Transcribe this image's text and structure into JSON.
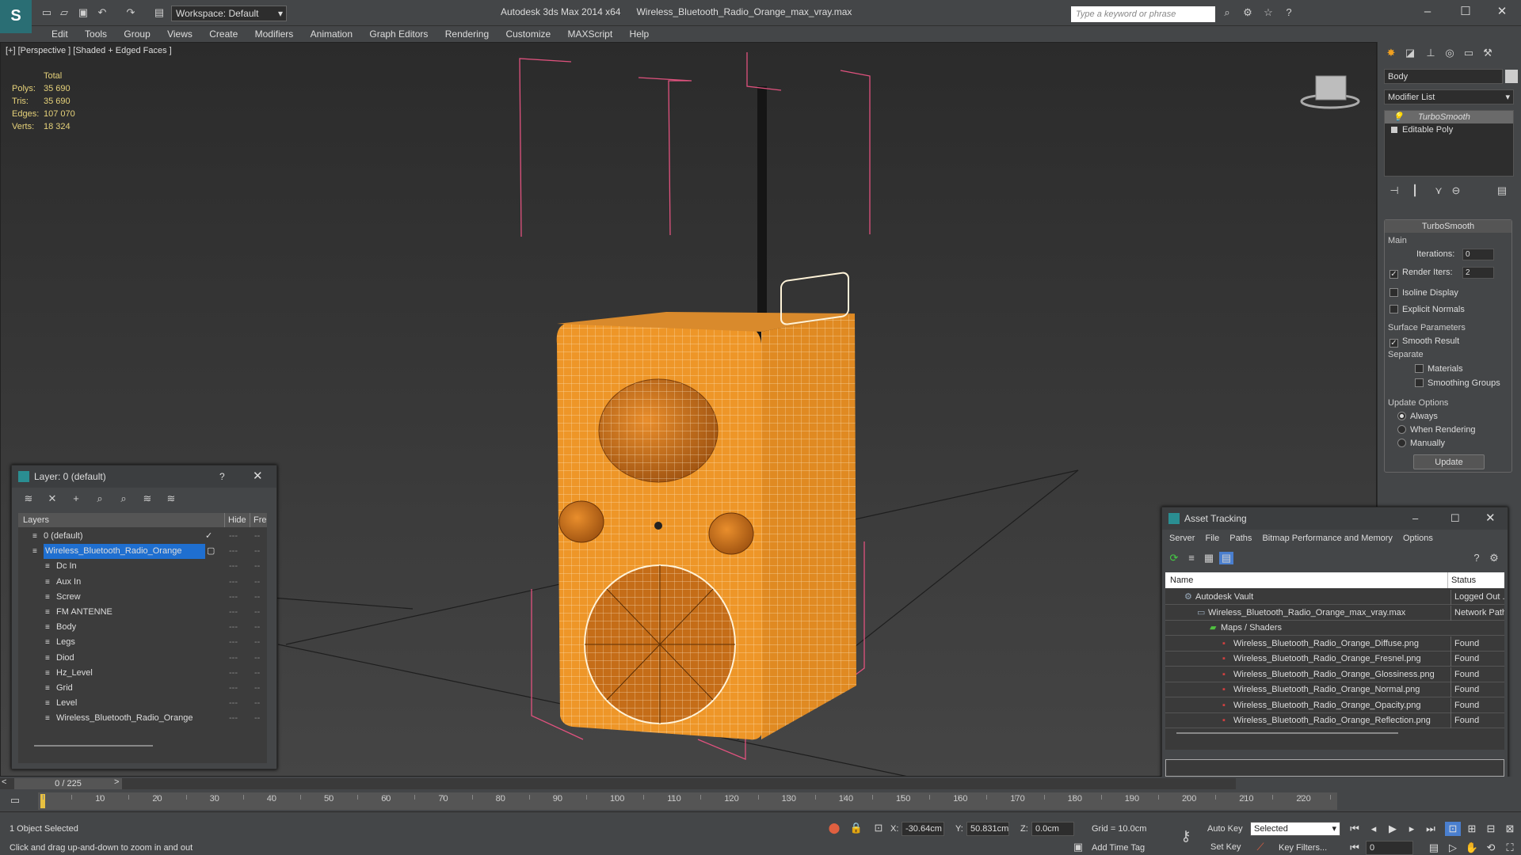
{
  "app": {
    "name": "Autodesk 3ds Max  2014 x64",
    "file": "Wireless_Bluetooth_Radio_Orange_max_vray.max",
    "workspace": "Workspace: Default",
    "search_placeholder": "Type a keyword or phrase"
  },
  "menu": [
    "Edit",
    "Tools",
    "Group",
    "Views",
    "Create",
    "Modifiers",
    "Animation",
    "Graph Editors",
    "Rendering",
    "Customize",
    "MAXScript",
    "Help"
  ],
  "viewport": {
    "label": "[+] [Perspective ] [Shaded + Edged Faces ]",
    "stats": {
      "header": "Total",
      "rows": [
        {
          "k": "Polys:",
          "v": "35 690"
        },
        {
          "k": "Tris:",
          "v": "35 690"
        },
        {
          "k": "Edges:",
          "v": "107 070"
        },
        {
          "k": "Verts:",
          "v": "18 324"
        }
      ]
    }
  },
  "command_panel": {
    "object_name": "Body",
    "modifier_list": "Modifier List",
    "stack": [
      "TurboSmooth",
      "Editable Poly"
    ],
    "rollout": {
      "title": "TurboSmooth",
      "main_label": "Main",
      "iterations_label": "Iterations:",
      "iterations": "0",
      "render_iters_label": "Render Iters:",
      "render_iters": "2",
      "isoline": "Isoline Display",
      "explicit_normals": "Explicit Normals",
      "surface_params": "Surface Parameters",
      "smooth_result": "Smooth Result",
      "separate": "Separate",
      "materials": "Materials",
      "smoothing_groups": "Smoothing Groups",
      "update_options": "Update Options",
      "always": "Always",
      "when_rendering": "When Rendering",
      "manually": "Manually",
      "update": "Update"
    }
  },
  "layer_panel": {
    "title": "Layer: 0 (default)",
    "help": "?",
    "col_layers": "Layers",
    "col_hide": "Hide",
    "col_freeze": "Fre",
    "rows": [
      {
        "name": "0 (default)",
        "indent": 0,
        "selected": false
      },
      {
        "name": "Wireless_Bluetooth_Radio_Orange",
        "indent": 0,
        "selected": true
      },
      {
        "name": "Dc In",
        "indent": 1,
        "selected": false
      },
      {
        "name": "Aux In",
        "indent": 1,
        "selected": false
      },
      {
        "name": "Screw",
        "indent": 1,
        "selected": false
      },
      {
        "name": "FM ANTENNE",
        "indent": 1,
        "selected": false
      },
      {
        "name": "Body",
        "indent": 1,
        "selected": false
      },
      {
        "name": "Legs",
        "indent": 1,
        "selected": false
      },
      {
        "name": "Diod",
        "indent": 1,
        "selected": false
      },
      {
        "name": "Hz_Level",
        "indent": 1,
        "selected": false
      },
      {
        "name": "Grid",
        "indent": 1,
        "selected": false
      },
      {
        "name": "Level",
        "indent": 1,
        "selected": false
      },
      {
        "name": "Wireless_Bluetooth_Radio_Orange",
        "indent": 1,
        "selected": false
      }
    ]
  },
  "asset_tracking": {
    "title": "Asset Tracking",
    "menu": [
      "Server",
      "File",
      "Paths",
      "Bitmap Performance and Memory",
      "Options"
    ],
    "col_name": "Name",
    "col_status": "Status",
    "rows": [
      {
        "name": "Autodesk Vault",
        "status": "Logged Out ...",
        "indent": 1
      },
      {
        "name": "Wireless_Bluetooth_Radio_Orange_max_vray.max",
        "status": "Network Path",
        "indent": 2
      },
      {
        "name": "Maps / Shaders",
        "status": "",
        "indent": 3
      },
      {
        "name": "Wireless_Bluetooth_Radio_Orange_Diffuse.png",
        "status": "Found",
        "indent": 4
      },
      {
        "name": "Wireless_Bluetooth_Radio_Orange_Fresnel.png",
        "status": "Found",
        "indent": 4
      },
      {
        "name": "Wireless_Bluetooth_Radio_Orange_Glossiness.png",
        "status": "Found",
        "indent": 4
      },
      {
        "name": "Wireless_Bluetooth_Radio_Orange_Normal.png",
        "status": "Found",
        "indent": 4
      },
      {
        "name": "Wireless_Bluetooth_Radio_Orange_Opacity.png",
        "status": "Found",
        "indent": 4
      },
      {
        "name": "Wireless_Bluetooth_Radio_Orange_Reflection.png",
        "status": "Found",
        "indent": 4
      }
    ]
  },
  "timeline": {
    "frame": "0 / 225",
    "ticks": [
      "10",
      "20",
      "30",
      "40",
      "50",
      "60",
      "70",
      "80",
      "90",
      "100",
      "110",
      "120",
      "130",
      "140",
      "150",
      "160",
      "170",
      "180",
      "190",
      "200",
      "210",
      "220"
    ]
  },
  "status": {
    "selected": "1 Object Selected",
    "hint": "Click and drag up-and-down to zoom in and out",
    "x_label": "X:",
    "x": "-30.64cm",
    "y_label": "Y:",
    "y": "50.831cm",
    "z_label": "Z:",
    "z": "0.0cm",
    "grid": "Grid = 10.0cm",
    "add_time_tag": "Add Time Tag",
    "auto_key": "Auto Key",
    "set_key": "Set Key",
    "selected_dropdown": "Selected",
    "key_filters": "Key Filters...",
    "frame_field": "0"
  }
}
